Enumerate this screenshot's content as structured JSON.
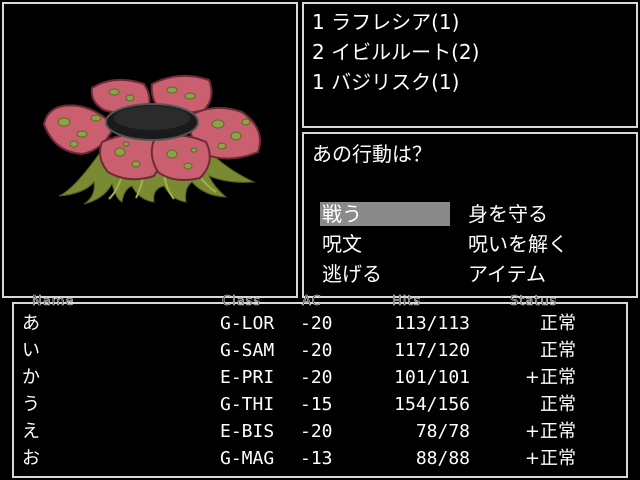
{
  "enemies": [
    {
      "text": "1 ラフレシア(1)"
    },
    {
      "text": "2 イビルルート(2)"
    },
    {
      "text": "1 バジリスク(1)"
    }
  ],
  "prompt": "あの行動は？",
  "commands": [
    {
      "label": "戦う",
      "selected": true
    },
    {
      "label": "身を守る"
    },
    {
      "label": "呪文"
    },
    {
      "label": "呪いを解く"
    },
    {
      "label": "逃げる"
    },
    {
      "label": "アイテム"
    }
  ],
  "party": {
    "headers": {
      "name": "Name",
      "class": "Class",
      "ac": "AC",
      "hits": "Hits",
      "status": "Status"
    },
    "members": [
      {
        "name": "あ",
        "class": "G-LOR",
        "ac": "-20",
        "hits": "113/113",
        "status": "正常"
      },
      {
        "name": "い",
        "class": "G-SAM",
        "ac": "-20",
        "hits": "117/120",
        "status": "正常"
      },
      {
        "name": "か",
        "class": "E-PRI",
        "ac": "-20",
        "hits": "101/101",
        "status": "+正常"
      },
      {
        "name": "う",
        "class": "G-THI",
        "ac": "-15",
        "hits": "154/156",
        "status": "正常"
      },
      {
        "name": "え",
        "class": "E-BIS",
        "ac": "-20",
        "hits": "78/78",
        "status": "+正常"
      },
      {
        "name": "お",
        "class": "G-MAG",
        "ac": "-13",
        "hits": "88/88",
        "status": "+正常"
      }
    ]
  },
  "colors": {
    "border": "#d8d8d8",
    "highlight": "#8a8a8a",
    "petal": "#c95f6f",
    "spot": "#8fa04a",
    "roots": "#7a8a32"
  }
}
